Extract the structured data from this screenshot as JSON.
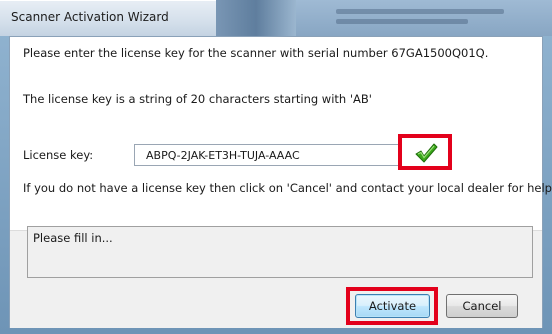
{
  "window": {
    "title": "Scanner Activation Wizard"
  },
  "dialog": {
    "instruction": "Please enter the license key for the scanner with serial number 67GA1500Q01Q.",
    "format_hint": "The license key is a string of 20 characters starting with 'AB'",
    "license_label": "License key:",
    "license_value": "ABPQ-2JAK-ET3H-TUJA-AAAC",
    "help_text": "If you do not have a license key then click on 'Cancel' and contact your local dealer for help.",
    "status_message": "Please fill in...",
    "validation_icon": "green-checkmark-icon"
  },
  "buttons": {
    "activate_label": "Activate",
    "cancel_label": "Cancel"
  },
  "colors": {
    "highlight": "#e3001b",
    "check": "#3aa81a"
  }
}
